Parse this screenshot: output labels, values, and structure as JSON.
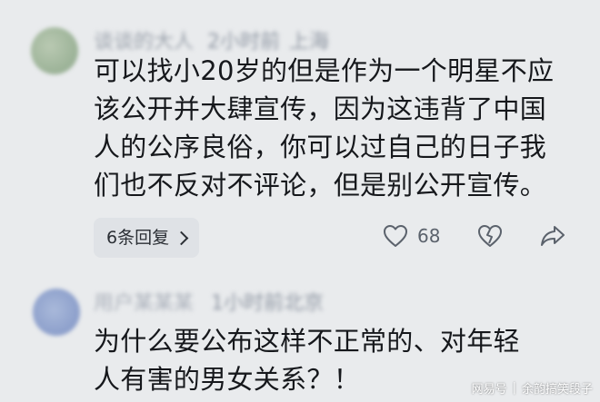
{
  "comments": [
    {
      "meta": {
        "username": "谈谈的大人",
        "time": "2小时前",
        "location": "上海"
      },
      "text": "可以找小20岁的但是作为一个明星不应该公开并大肆宣传，因为这违背了中国人的公序良俗，你可以过自己的日子我们也不反对不评论，但是别公开宣传。",
      "reply_label": "6条回复",
      "like_count": "68"
    },
    {
      "meta": {
        "username": "用户某某某",
        "time": "1小时前",
        "location": "北京"
      },
      "text": "为什么要公布这样不正常的、对年轻人有害的男女关系？！"
    }
  ],
  "watermark": {
    "source": "网易号",
    "separator": "|",
    "author": "余韵搞笑段子"
  }
}
